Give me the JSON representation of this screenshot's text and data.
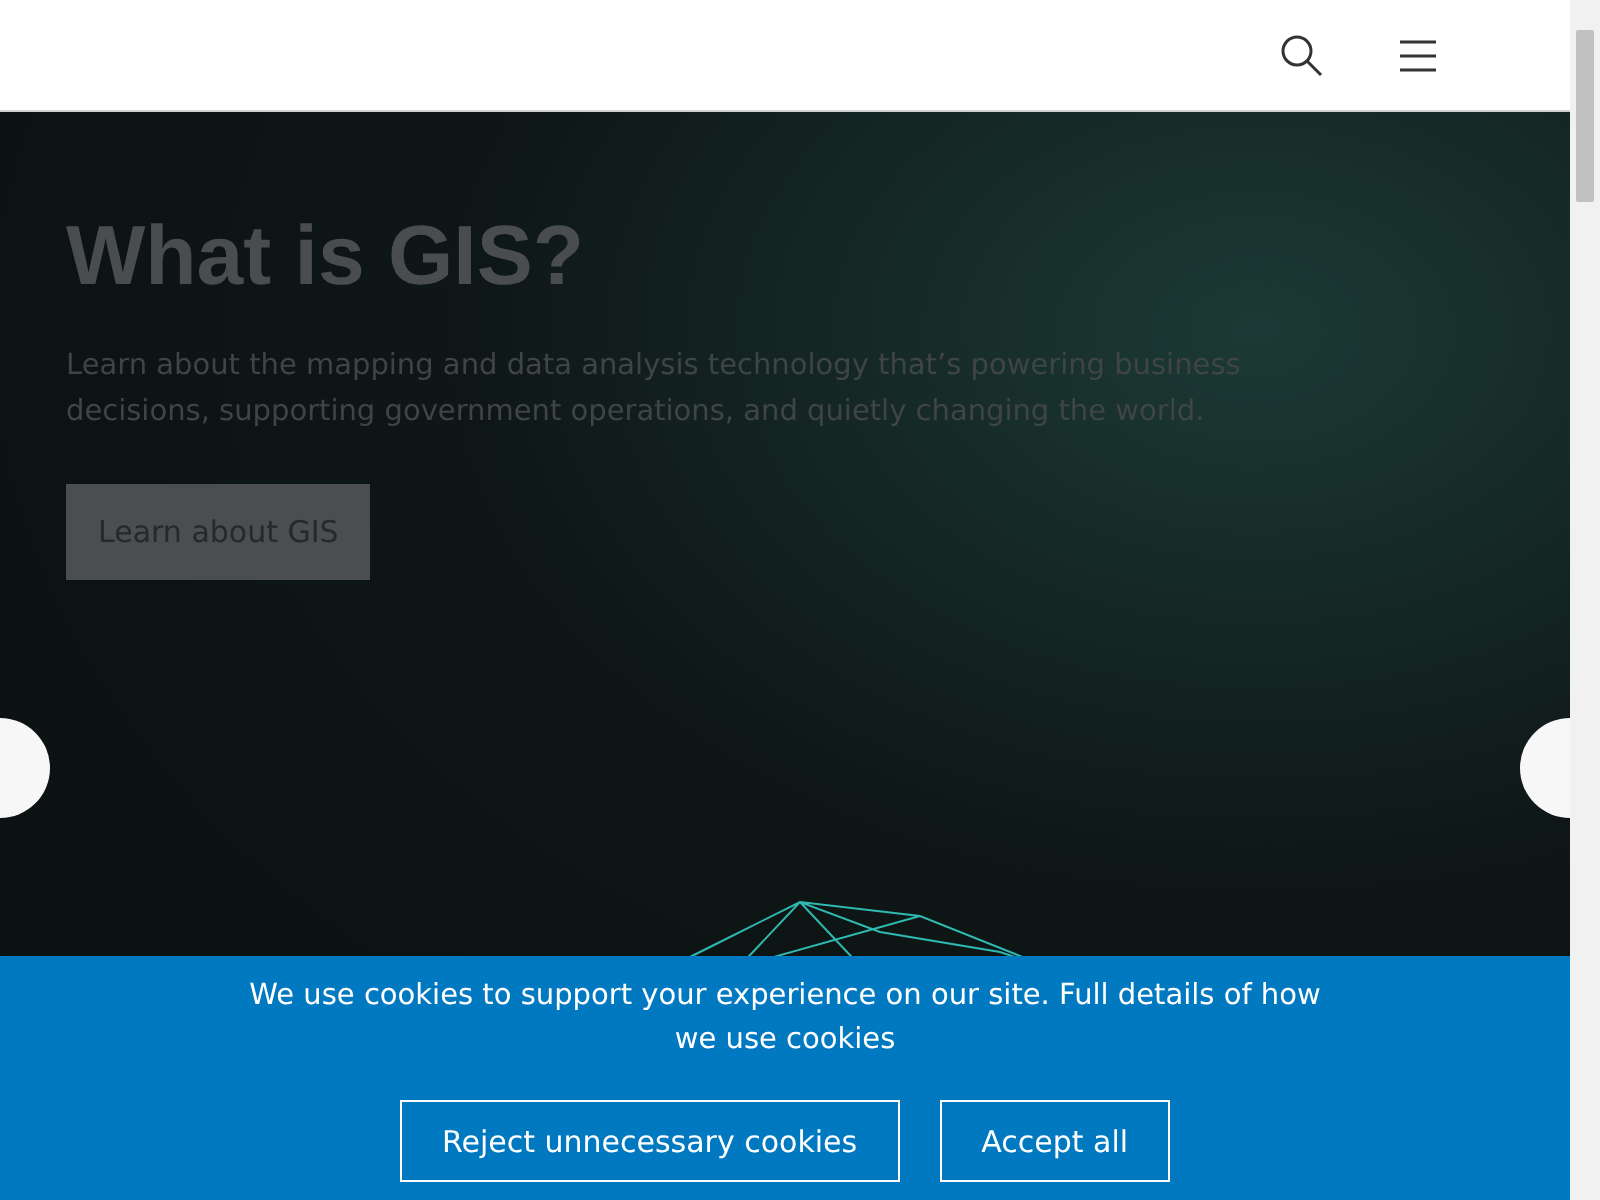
{
  "hero": {
    "title": "What is GIS?",
    "text": "Learn about the mapping and data analysis technology that’s powering business decisions, supporting government operations, and quietly changing the world.",
    "button": "Learn about GIS"
  },
  "cookie_banner": {
    "message": "We use cookies to support your experience on our site. Full details of how we use cookies",
    "buttons": [
      "Reject unnecessary cookies",
      "Accept all"
    ]
  }
}
